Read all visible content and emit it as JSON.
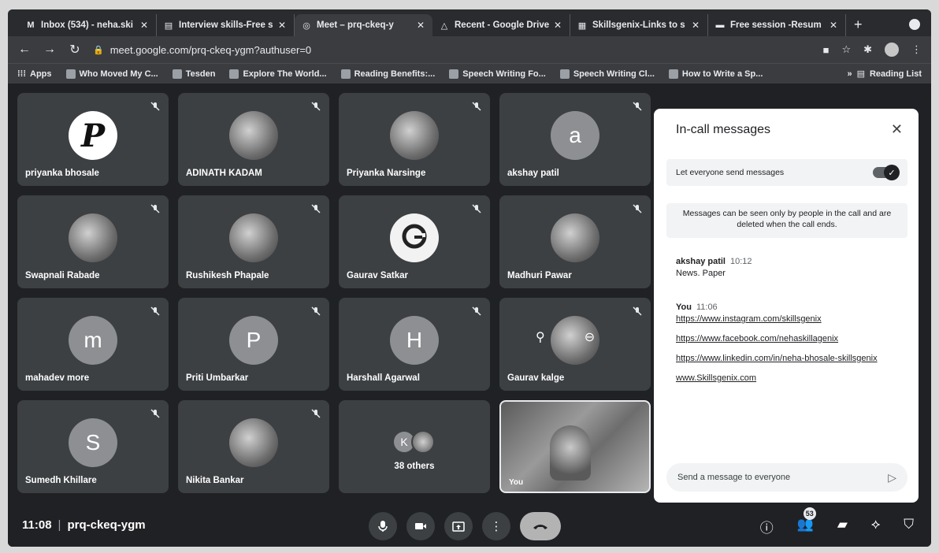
{
  "browser": {
    "tabs": [
      {
        "icon": "M",
        "label": "Inbox (534) - neha.ski"
      },
      {
        "icon": "▤",
        "label": "Interview skills-Free s"
      },
      {
        "icon": "◎",
        "label": "Meet – prq-ckeq-y"
      },
      {
        "icon": "△",
        "label": "Recent - Google Drive"
      },
      {
        "icon": "▦",
        "label": "Skillsgenix-Links to s"
      },
      {
        "icon": "▬",
        "label": "Free session -Resum"
      }
    ],
    "new_tab": "+",
    "url": "meet.google.com/prq-ckeq-ygm?authuser=0",
    "bookmarks": [
      "Apps",
      "Who Moved My C...",
      "Tesden",
      "Explore The World...",
      "Reading Benefits:...",
      "Speech Writing Fo...",
      "Speech Writing Cl...",
      "How to Write a Sp..."
    ],
    "more_bookmarks": "»",
    "reading_list": "Reading List"
  },
  "participants": [
    {
      "name": "priyanka bhosale",
      "avatar": "P",
      "style": "logo-p"
    },
    {
      "name": "ADINATH KADAM",
      "avatar": "",
      "style": "photo"
    },
    {
      "name": "Priyanka Narsinge",
      "avatar": "",
      "style": "photo"
    },
    {
      "name": "akshay patil",
      "avatar": "a",
      "style": "letter"
    },
    {
      "name": "Swapnali Rabade",
      "avatar": "",
      "style": "photo"
    },
    {
      "name": "Rushikesh Phapale",
      "avatar": "",
      "style": "photo"
    },
    {
      "name": "Gaurav Satkar",
      "avatar": "",
      "style": "logo-g"
    },
    {
      "name": "Madhuri Pawar",
      "avatar": "",
      "style": "photo"
    },
    {
      "name": "mahadev more",
      "avatar": "m",
      "style": "letter"
    },
    {
      "name": "Priti Umbarkar",
      "avatar": "P",
      "style": "letter"
    },
    {
      "name": "Harshall Agarwal",
      "avatar": "H",
      "style": "letter"
    },
    {
      "name": "Gaurav kalge",
      "avatar": "",
      "style": "photo"
    },
    {
      "name": "Sumedh Khillare",
      "avatar": "S",
      "style": "letter"
    },
    {
      "name": "Nikita Bankar",
      "avatar": "",
      "style": "photo"
    }
  ],
  "others": {
    "initial": "K",
    "label": "38 others"
  },
  "self_tile": {
    "label": "You"
  },
  "panel": {
    "title": "In-call messages",
    "setting_label": "Let everyone send messages",
    "info": "Messages can be seen only by people in the call and are deleted when the call ends.",
    "messages": [
      {
        "sender": "akshay patil",
        "time": "10:12",
        "lines": [
          "News. Paper"
        ]
      },
      {
        "sender": "You",
        "time": "11:06",
        "links": [
          "https://www.instagram.com/skillsgenix",
          "https://www.facebook.com/nehaskillagenix",
          "https://www.linkedin.com/in/neha-bhosale-skillsgenix",
          "www.Skillsgenix.com"
        ]
      }
    ],
    "input_placeholder": "Send a message to everyone"
  },
  "bottom": {
    "time": "11:08",
    "meeting_code": "prq-ckeq-ygm",
    "people_count": "53"
  }
}
